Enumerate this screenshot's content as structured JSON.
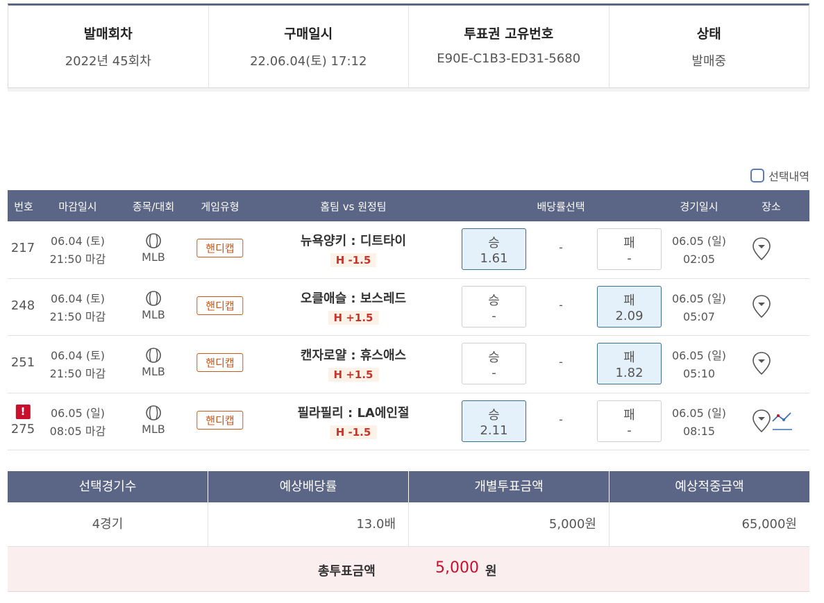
{
  "info": {
    "round_label": "발매회차",
    "round_value": "2022년 45회차",
    "purchase_label": "구매일시",
    "purchase_value": "22.06.04(토) 17:12",
    "ticket_label": "투표권 고유번호",
    "ticket_value": "E90E-C1B3-ED31-5680",
    "status_label": "상태",
    "status_value": "발매중"
  },
  "selection": {
    "label": "선택내역"
  },
  "games": {
    "headers": {
      "no": "번호",
      "deadline": "마감일시",
      "sport": "종목/대회",
      "type": "게임유형",
      "teams": "홈팀 vs 원정팀",
      "odds": "배당률선택",
      "date": "경기일시",
      "venue": "장소"
    },
    "rows": [
      {
        "no": "217",
        "deadline_date": "06.04 (토)",
        "deadline_time": "21:50 마감",
        "sport": "MLB",
        "type": "핸디캡",
        "teams": "뉴욕양키 : 디트타이",
        "handicap": "H -1.5",
        "win_label": "승",
        "win_value": "1.61",
        "draw": "-",
        "lose_label": "패",
        "lose_value": "-",
        "game_date": "06.05 (일)",
        "game_time": "02:05",
        "selected": "win"
      },
      {
        "no": "248",
        "deadline_date": "06.04 (토)",
        "deadline_time": "21:50 마감",
        "sport": "MLB",
        "type": "핸디캡",
        "teams": "오클애슬 : 보스레드",
        "handicap": "H +1.5",
        "win_label": "승",
        "win_value": "-",
        "draw": "-",
        "lose_label": "패",
        "lose_value": "2.09",
        "game_date": "06.05 (일)",
        "game_time": "05:07",
        "selected": "lose"
      },
      {
        "no": "251",
        "deadline_date": "06.04 (토)",
        "deadline_time": "21:50 마감",
        "sport": "MLB",
        "type": "핸디캡",
        "teams": "캔자로얄 : 휴스애스",
        "handicap": "H +1.5",
        "win_label": "승",
        "win_value": "-",
        "draw": "-",
        "lose_label": "패",
        "lose_value": "1.82",
        "game_date": "06.05 (일)",
        "game_time": "05:10",
        "selected": "lose"
      },
      {
        "no": "275",
        "warn_mark": "!",
        "deadline_date": "06.05 (일)",
        "deadline_time": "08:05 마감",
        "sport": "MLB",
        "type": "핸디캡",
        "teams": "필라필리 : LA에인절",
        "handicap": "H -1.5",
        "win_label": "승",
        "win_value": "2.11",
        "draw": "-",
        "lose_label": "패",
        "lose_value": "-",
        "game_date": "06.05 (일)",
        "game_time": "08:15",
        "selected": "win"
      }
    ]
  },
  "summary": {
    "headers": [
      "선택경기수",
      "예상배당률",
      "개별투표금액",
      "예상적중금액"
    ],
    "values": [
      "4경기",
      "13.0배",
      "5,000원",
      "65,000원"
    ],
    "total_label": "총투표금액",
    "total_amount": "5,000",
    "total_unit": "원"
  },
  "colors": {
    "header_bg": "#5b6585",
    "selected_odds_bg": "#e5f1fa",
    "selected_odds_border": "#3f6d8e",
    "accent_red": "#c8102e",
    "handicap_orange": "#c7561a",
    "total_bg": "#fbeeee"
  }
}
